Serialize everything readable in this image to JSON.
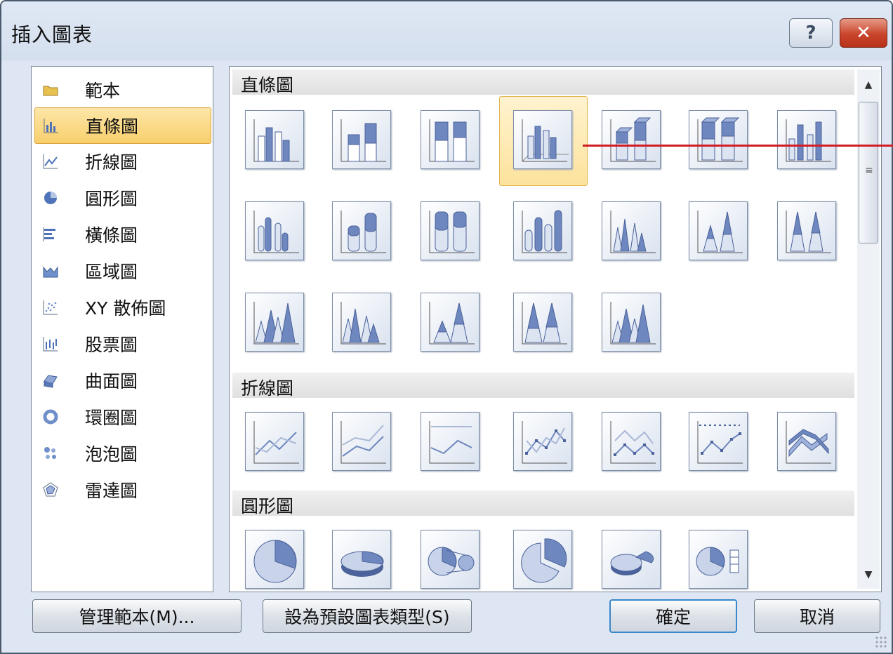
{
  "window": {
    "title": "插入圖表",
    "help_label": "?",
    "close_label": "✕"
  },
  "categories": [
    {
      "label": "範本",
      "icon": "folder-icon",
      "selected": false
    },
    {
      "label": "直條圖",
      "icon": "column-chart-icon",
      "selected": true
    },
    {
      "label": "折線圖",
      "icon": "line-chart-icon",
      "selected": false
    },
    {
      "label": "圓形圖",
      "icon": "pie-chart-icon",
      "selected": false
    },
    {
      "label": "橫條圖",
      "icon": "bar-chart-icon",
      "selected": false
    },
    {
      "label": "區域圖",
      "icon": "area-chart-icon",
      "selected": false
    },
    {
      "label": "XY 散佈圖",
      "icon": "scatter-chart-icon",
      "selected": false
    },
    {
      "label": "股票圖",
      "icon": "stock-chart-icon",
      "selected": false
    },
    {
      "label": "曲面圖",
      "icon": "surface-chart-icon",
      "selected": false
    },
    {
      "label": "環圈圖",
      "icon": "doughnut-chart-icon",
      "selected": false
    },
    {
      "label": "泡泡圖",
      "icon": "bubble-chart-icon",
      "selected": false
    },
    {
      "label": "雷達圖",
      "icon": "radar-chart-icon",
      "selected": false
    }
  ],
  "gallery": {
    "sections": [
      {
        "title": "直條圖"
      },
      {
        "title": "折線圖"
      },
      {
        "title": "圓形圖"
      }
    ],
    "selected_thumbnail": "column-3d-clustered"
  },
  "buttons": {
    "manage_templates": "管理範本(M)...",
    "set_default": "設為預設圖表類型(S)",
    "ok": "確定",
    "cancel": "取消"
  },
  "colors": {
    "selection_fill": "#f8cf6c",
    "accent_blue": "#3a88c8",
    "pointer_line": "#d21d25",
    "chart_blue": "#5a74a8"
  }
}
